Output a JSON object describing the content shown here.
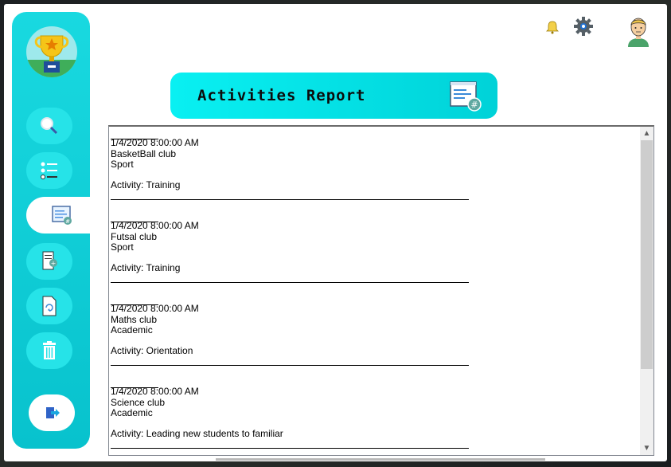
{
  "window": {
    "title": "Activities Report"
  },
  "sidebar": {
    "items": [
      {
        "name": "search",
        "icon": "magnifier-icon"
      },
      {
        "name": "list",
        "icon": "list-icon"
      },
      {
        "name": "report",
        "icon": "report-icon",
        "active": true
      },
      {
        "name": "add-activity",
        "icon": "add-document-icon"
      },
      {
        "name": "refresh",
        "icon": "refresh-document-icon"
      },
      {
        "name": "delete",
        "icon": "trash-icon"
      }
    ],
    "exit_icon": "logout-icon"
  },
  "header": {
    "bell_icon": "bell-icon",
    "settings_icon": "gear-icon",
    "avatar_icon": "user-avatar-icon"
  },
  "banner": {
    "title": "Activities Report",
    "icon": "report-hash-icon"
  },
  "report": {
    "entries": [
      {
        "date": "1/4/2020 8:00:00 AM",
        "club": "BasketBall club",
        "category": "Sport",
        "activity": "Activity: Training"
      },
      {
        "date": "1/4/2020 8:00:00 AM",
        "club": "Futsal club",
        "category": "Sport",
        "activity": "Activity: Training"
      },
      {
        "date": "1/4/2020 8:00:00 AM",
        "club": "Maths club",
        "category": "Academic",
        "activity": "Activity: Orientation"
      },
      {
        "date": "1/4/2020 8:00:00 AM",
        "club": "Science club",
        "category": "Academic",
        "activity": "Activity: Leading new students to familiar"
      }
    ]
  },
  "colors": {
    "accent": "#09f0f2",
    "sidebar": "#19d9e0",
    "nav_button": "#26e3e8"
  }
}
